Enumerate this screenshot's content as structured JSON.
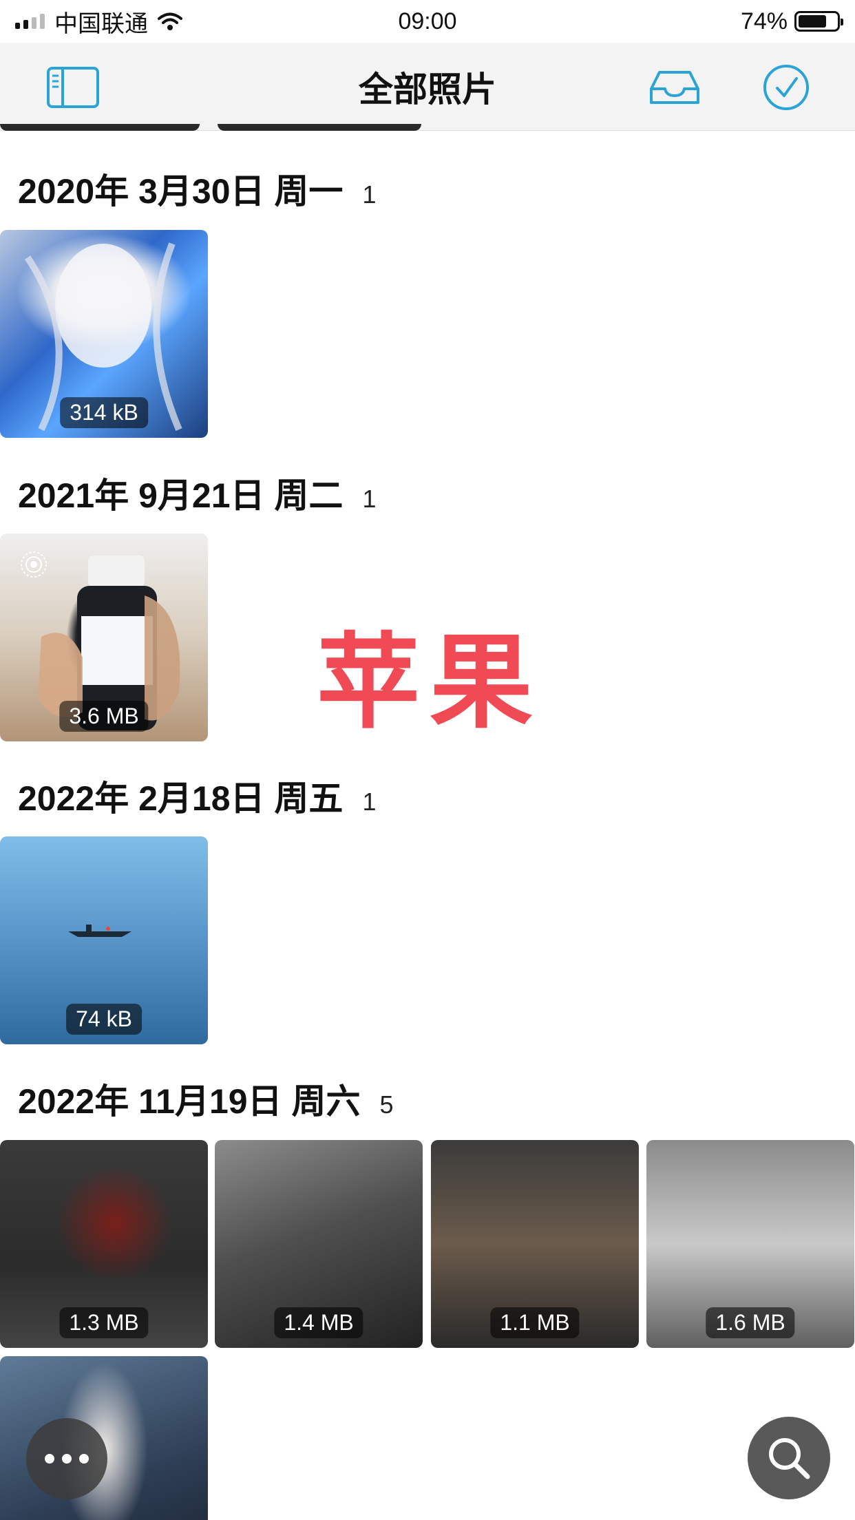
{
  "status_bar": {
    "carrier": "中国联通",
    "time": "09:00",
    "battery_percent": "74%",
    "battery_level": 0.74,
    "signal_icon": "cellular-signal-icon",
    "wifi_icon": "wifi-icon"
  },
  "nav": {
    "title": "全部照片",
    "sidebar_icon": "sidebar-icon",
    "inbox_icon": "inbox-icon",
    "select_icon": "checkmark-circle-icon",
    "accent_color": "#2aa3d6"
  },
  "sections": [
    {
      "date": "2020年 3月30日 周一",
      "count": "1",
      "items": [
        {
          "size": "314 kB"
        }
      ]
    },
    {
      "date": "2021年 9月21日 周二",
      "count": "1",
      "items": [
        {
          "size": "3.6 MB",
          "live": true
        }
      ]
    },
    {
      "date": "2022年 2月18日 周五",
      "count": "1",
      "items": [
        {
          "size": "74 kB"
        }
      ]
    },
    {
      "date": "2022年 11月19日 周六",
      "count": "5",
      "items": [
        {
          "size": "1.3 MB"
        },
        {
          "size": "1.4 MB"
        },
        {
          "size": "1.1 MB"
        },
        {
          "size": "1.6 MB"
        },
        {
          "size": ""
        }
      ]
    }
  ],
  "overlay": {
    "watermark": "苹果",
    "watermark_color": "#f04a55",
    "more_icon": "more-icon",
    "search_icon": "search-icon"
  }
}
